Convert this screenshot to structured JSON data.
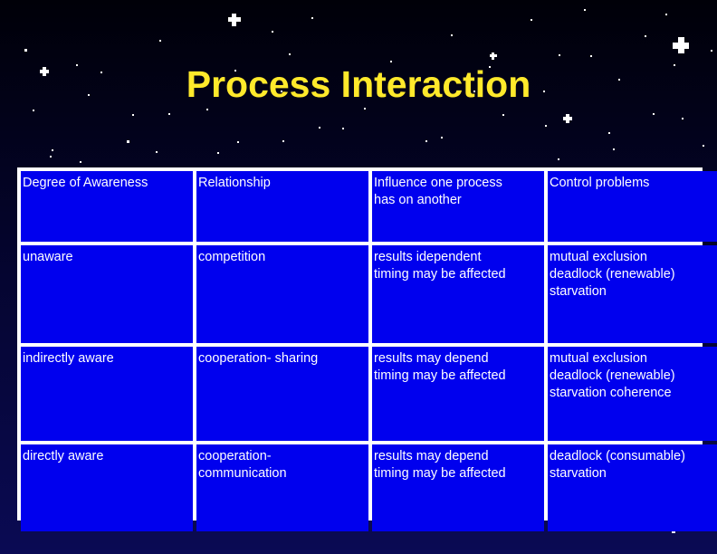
{
  "slide": {
    "title": "Process Interaction",
    "title_color": "#ffe92b",
    "background_color": "#05053a",
    "cell_color": "#0000ee",
    "grid_color": "#ffffff",
    "text_color": "#ffffff"
  },
  "table": {
    "columns": [
      {
        "header_lines": [
          "Degree of Awareness"
        ]
      },
      {
        "header_lines": [
          "Relationship"
        ]
      },
      {
        "header_lines": [
          "Influence one process",
          " has on another"
        ]
      },
      {
        "header_lines": [
          "Control problems"
        ]
      }
    ],
    "rows": [
      {
        "cells": [
          {
            "lines": [
              "unaware"
            ]
          },
          {
            "lines": [
              "competition"
            ]
          },
          {
            "lines": [
              "results idependent",
              "timing may be affected"
            ]
          },
          {
            "lines": [
              "mutual exclusion",
              "deadlock (renewable)",
              "starvation"
            ]
          }
        ]
      },
      {
        "cells": [
          {
            "lines": [
              "indirectly aware"
            ]
          },
          {
            "lines": [
              "cooperation- sharing"
            ]
          },
          {
            "lines": [
              "results may depend",
              "timing may be affected"
            ]
          },
          {
            "lines": [
              "mutual exclusion",
              "deadlock (renewable)",
              "starvation coherence"
            ]
          }
        ]
      },
      {
        "cells": [
          {
            "lines": [
              "directly aware"
            ]
          },
          {
            "lines": [
              "cooperation-",
              "communication"
            ]
          },
          {
            "lines": [
              "results may depend",
              "timing may be affected"
            ]
          },
          {
            "lines": [
              "deadlock (consumable)",
              "starvation"
            ]
          }
        ]
      }
    ]
  },
  "stars": {
    "dots": [
      [
        27,
        54,
        3
      ],
      [
        84,
        71,
        2
      ],
      [
        111,
        79,
        2
      ],
      [
        176,
        44,
        2
      ],
      [
        140,
        155,
        3
      ],
      [
        57,
        165,
        2
      ],
      [
        146,
        126,
        2
      ],
      [
        186,
        125,
        2
      ],
      [
        228,
        120,
        2
      ],
      [
        300,
        34,
        2
      ],
      [
        259,
        77,
        2
      ],
      [
        319,
        59,
        2
      ],
      [
        310,
        100,
        2
      ],
      [
        344,
        19,
        2
      ],
      [
        352,
        140,
        2
      ],
      [
        378,
        141,
        2
      ],
      [
        312,
        155,
        2
      ],
      [
        262,
        156,
        2
      ],
      [
        402,
        119,
        2
      ],
      [
        431,
        67,
        2
      ],
      [
        470,
        155,
        2
      ],
      [
        487,
        151,
        2
      ],
      [
        498,
        38,
        2
      ],
      [
        523,
        100,
        2
      ],
      [
        540,
        73,
        2
      ],
      [
        555,
        126,
        2
      ],
      [
        586,
        21,
        2
      ],
      [
        600,
        100,
        2
      ],
      [
        617,
        60,
        2
      ],
      [
        616,
        175,
        2
      ],
      [
        645,
        10,
        2
      ],
      [
        652,
        61,
        2
      ],
      [
        672,
        146,
        2
      ],
      [
        677,
        164,
        2
      ],
      [
        683,
        87,
        2
      ],
      [
        712,
        39,
        2
      ],
      [
        721,
        125,
        2
      ],
      [
        735,
        15,
        2
      ],
      [
        744,
        71,
        2
      ],
      [
        753,
        130,
        2
      ],
      [
        776,
        160,
        2
      ],
      [
        785,
        55,
        2
      ],
      [
        602,
        138,
        2
      ],
      [
        455,
        99,
        2
      ],
      [
        240,
        168,
        2
      ],
      [
        172,
        167,
        2
      ],
      [
        36,
        121,
        2
      ],
      [
        55,
        172,
        2
      ],
      [
        88,
        178,
        2
      ],
      [
        97,
        104,
        2
      ]
    ],
    "sparkles": [
      [
        49,
        79,
        5
      ],
      [
        627,
        131,
        5
      ],
      [
        545,
        62,
        4
      ],
      [
        259,
        22,
        7
      ],
      [
        752,
        50,
        9
      ]
    ],
    "bottom_marks": [
      [
        30,
        576,
        5,
        7
      ],
      [
        742,
        582,
        4,
        7
      ]
    ]
  }
}
